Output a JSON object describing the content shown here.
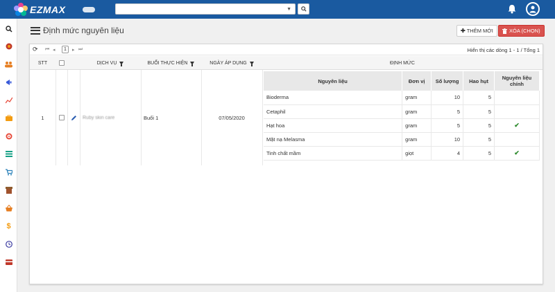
{
  "app": {
    "brand": "EZMAX"
  },
  "page": {
    "title": "Định mức nguyên liệu"
  },
  "toolbar": {
    "add_label": "THÊM MỚI",
    "delete_label": "XÓA (CHỌN)"
  },
  "pager": {
    "current_page": "1",
    "info": "Hiển thị các dòng 1 - 1 / Tổng 1"
  },
  "columns": {
    "stt": "STT",
    "service": "DỊCH VỤ",
    "session": "BUỔI THỰC HIỆN",
    "apply_date": "NGÀY ÁP DỤNG",
    "norm": "ĐỊNH MỨC"
  },
  "row": {
    "stt": "1",
    "service": "Ruby skin care",
    "session": "Buổi 1",
    "apply_date": "07/05/2020"
  },
  "inner_columns": {
    "material": "Nguyên liệu",
    "unit": "Đơn vị",
    "quantity": "Số lượng",
    "loss": "Hao hụt",
    "main": "Nguyên liệu chính"
  },
  "materials": [
    {
      "name": "Bioderma",
      "unit": "gram",
      "quantity": "10",
      "loss": "5",
      "main": false
    },
    {
      "name": "Cetaphil",
      "unit": "gram",
      "quantity": "5",
      "loss": "5",
      "main": false
    },
    {
      "name": "Hạt hoa",
      "unit": "gram",
      "quantity": "5",
      "loss": "5",
      "main": true
    },
    {
      "name": "Mặt nạ Melasma",
      "unit": "gram",
      "quantity": "10",
      "loss": "5",
      "main": false
    },
    {
      "name": "Tinh chất mầm",
      "unit": "giọt",
      "quantity": "4",
      "loss": "5",
      "main": true
    }
  ],
  "colors": {
    "topbar": "#1a5aa0",
    "delete": "#d9534f",
    "check": "#2e8b2e"
  }
}
